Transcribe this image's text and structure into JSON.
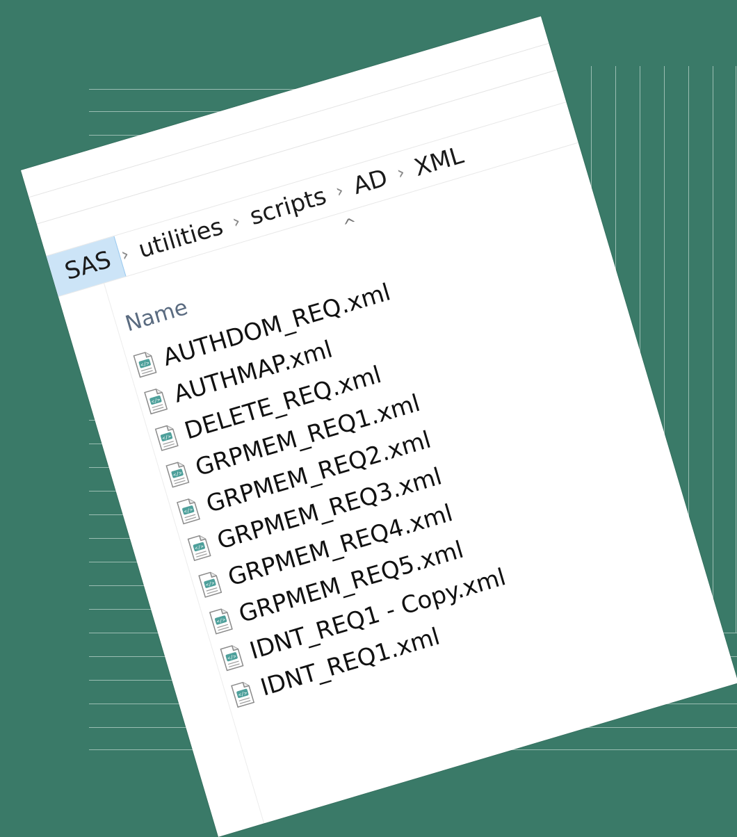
{
  "breadcrumb": {
    "items": [
      "SAS",
      "utilities",
      "scripts",
      "AD",
      "XML"
    ],
    "separator": "›"
  },
  "list": {
    "column_header": "Name",
    "sort_indicator": "^",
    "files": [
      "AUTHDOM_REQ.xml",
      "AUTHMAP.xml",
      "DELETE_REQ.xml",
      "GRPMEM_REQ1.xml",
      "GRPMEM_REQ2.xml",
      "GRPMEM_REQ3.xml",
      "GRPMEM_REQ4.xml",
      "GRPMEM_REQ5.xml",
      "IDNT_REQ1 - Copy.xml",
      "IDNT_REQ1.xml"
    ]
  },
  "colors": {
    "background": "#3a7a68",
    "selected_crumb": "#cce4f7"
  },
  "icons": {
    "file": "xml-file-icon"
  }
}
